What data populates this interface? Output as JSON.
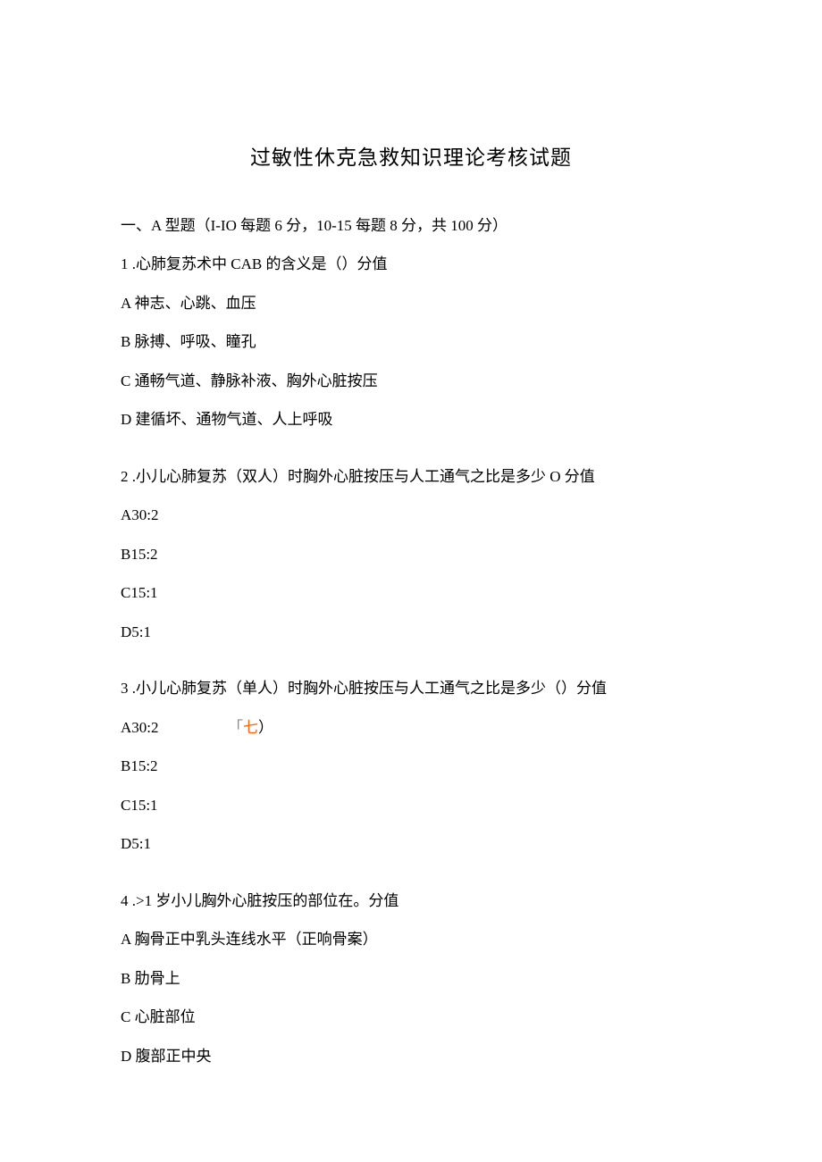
{
  "title": "过敏性休克急救知识理论考核试题",
  "section_header": "一、A 型题（I-IO 每题 6 分，10-15 每题 8 分，共 100 分）",
  "q1": {
    "stem": "1 .心肺复苏术中 CAB 的含义是（）分值",
    "a": "A 神志、心跳、血压",
    "b": "B 脉搏、呼吸、瞳孔",
    "c": "C 通畅气道、静脉补液、胸外心脏按压",
    "d": "D 建循坏、通物气道、人上呼吸"
  },
  "q2": {
    "stem": "2 .小儿心肺复苏（双人）时胸外心脏按压与人工通气之比是多少 O 分值",
    "a": "A30:2",
    "b": "B15:2",
    "c": "C15:1",
    "d": "D5:1"
  },
  "q3": {
    "stem": "3 .小儿心肺复苏（单人）时胸外心脏按压与人工通气之比是多少（）分值",
    "a_first": "A30:2",
    "a_annot_prefix": "「",
    "a_annot_main": "七",
    "a_annot_suffix": "）",
    "b": "B15:2",
    "c": "C15:1",
    "d": "D5:1"
  },
  "q4": {
    "stem": "4 .>1 岁小儿胸外心脏按压的部位在。分值",
    "a": "A 胸骨正中乳头连线水平（正响骨案）",
    "b": "B 肋骨上",
    "c": "C 心脏部位",
    "d": "D 腹部正中央"
  }
}
